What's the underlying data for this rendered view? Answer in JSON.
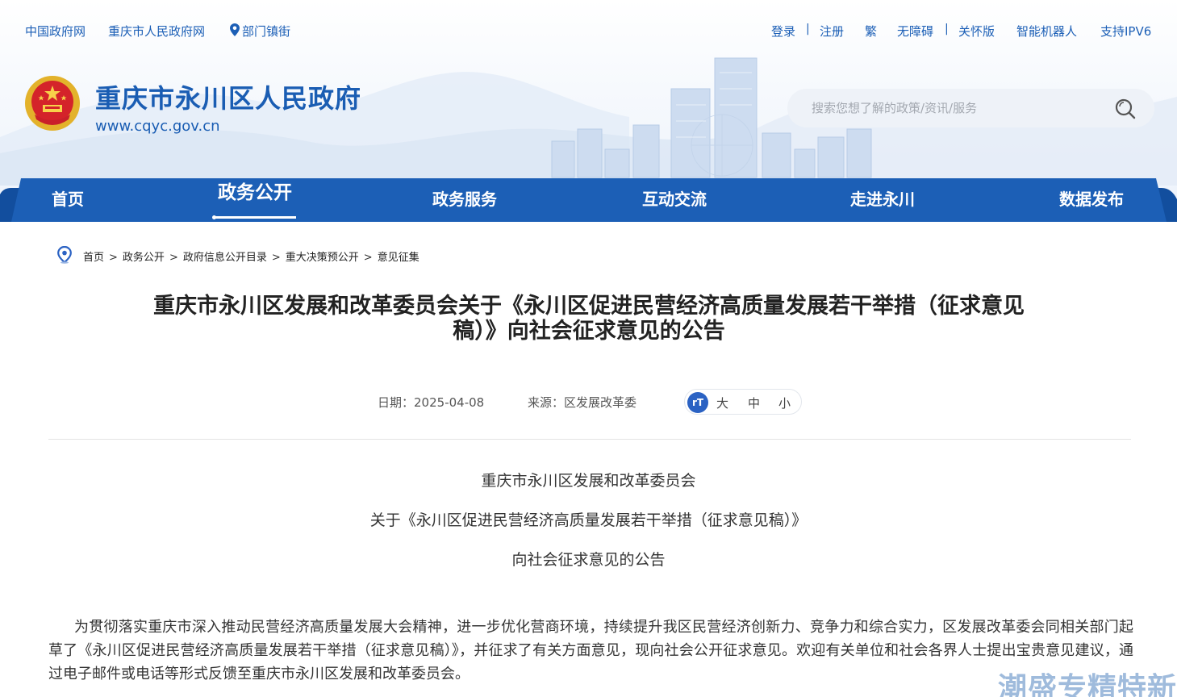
{
  "toplinks": {
    "left": [
      "中国政府网",
      "重庆市人民政府网",
      "部门镇街"
    ],
    "right": [
      "登录",
      "注册",
      "繁",
      "无障碍",
      "关怀版",
      "智能机器人",
      "支持IPV6"
    ]
  },
  "header": {
    "site_title": "重庆市永川区人民政府",
    "site_url": "www.cqyc.gov.cn",
    "search_placeholder": "搜索您想了解的政策/资讯/服务"
  },
  "nav": {
    "items": [
      "首页",
      "政务公开",
      "政务服务",
      "互动交流",
      "走进永川",
      "数据发布"
    ],
    "active_index": 1
  },
  "breadcrumb": [
    "首页",
    "政务公开",
    "政府信息公开目录",
    "重大决策预公开",
    "意见征集"
  ],
  "article": {
    "title_line1": "重庆市永川区发展和改革委员会关于《永川区促进民营经济高质量发展若干举措（征求意见",
    "title_line2": "稿）》向社会征求意见的公告",
    "date_label": "日期：",
    "date": "2025-04-08",
    "source_label": "来源：",
    "source": "区发展改革委",
    "font_sizes": [
      "大",
      "中",
      "小"
    ],
    "heading_lines": [
      "重庆市永川区发展和改革委员会",
      "关于《永川区促进民营经济高质量发展若干举措（征求意见稿）》",
      "向社会征求意见的公告"
    ],
    "paragraph": "为贯彻落实重庆市深入推动民营经济高质量发展大会精神，进一步优化营商环境，持续提升我区民营经济创新力、竞争力和综合实力，区发展改革委会同相关部门起草了《永川区促进民营经济高质量发展若干举措（征求意见稿）》，并征求了有关方面意见，现向社会公开征求意见。欢迎有关单位和社会各界人士提出宝贵意见建议，通过电子邮件或电话等形式反馈至重庆市永川区发展和改革委员会。"
  },
  "watermark": "潮盛专精特新",
  "colors": {
    "brand_blue": "#1a5db3",
    "nav_blue": "#1c5fb6",
    "nav_dark": "#124e9e"
  }
}
